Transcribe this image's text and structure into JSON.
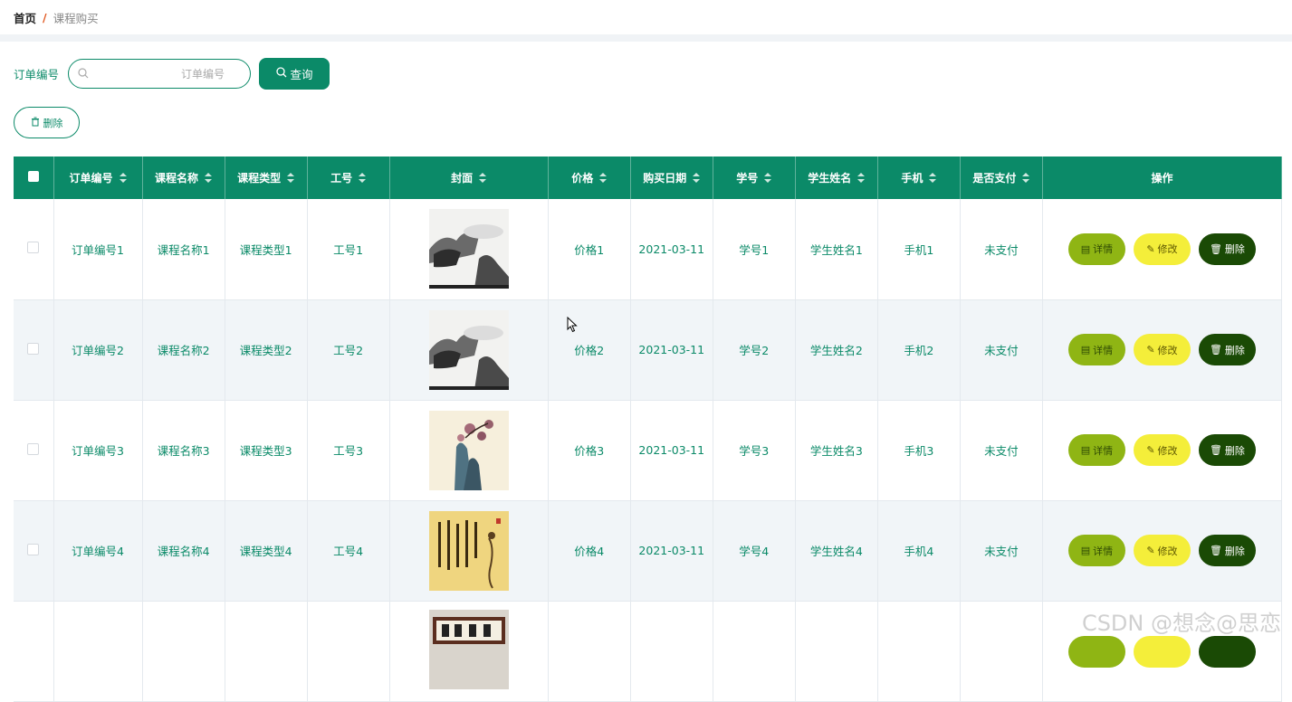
{
  "breadcrumb": {
    "home": "首页",
    "separator": "/",
    "current": "课程购买"
  },
  "search": {
    "label": "订单编号",
    "placeholder": "订单编号",
    "value": "",
    "button_label": "查询"
  },
  "toolbar": {
    "delete_label": "删除"
  },
  "table": {
    "columns": [
      "订单编号",
      "课程名称",
      "课程类型",
      "工号",
      "封面",
      "价格",
      "购买日期",
      "学号",
      "学生姓名",
      "手机",
      "是否支付",
      "操作"
    ],
    "rows": [
      {
        "order_no": "订单编号1",
        "course_name": "课程名称1",
        "course_type": "课程类型1",
        "staff_no": "工号1",
        "cover": "ink-landscape",
        "price": "价格1",
        "date": "2021-03-11",
        "student_no": "学号1",
        "student_name": "学生姓名1",
        "phone": "手机1",
        "paid": "未支付"
      },
      {
        "order_no": "订单编号2",
        "course_name": "课程名称2",
        "course_type": "课程类型2",
        "staff_no": "工号2",
        "cover": "ink-landscape",
        "price": "价格2",
        "date": "2021-03-11",
        "student_no": "学号2",
        "student_name": "学生姓名2",
        "phone": "手机2",
        "paid": "未支付"
      },
      {
        "order_no": "订单编号3",
        "course_name": "课程名称3",
        "course_type": "课程类型3",
        "staff_no": "工号3",
        "cover": "plum-blossom-rock",
        "price": "价格3",
        "date": "2021-03-11",
        "student_no": "学号3",
        "student_name": "学生姓名3",
        "phone": "手机3",
        "paid": "未支付"
      },
      {
        "order_no": "订单编号4",
        "course_name": "课程名称4",
        "course_type": "课程类型4",
        "staff_no": "工号4",
        "cover": "calligraphy-figure",
        "price": "价格4",
        "date": "2021-03-11",
        "student_no": "学号4",
        "student_name": "学生姓名4",
        "phone": "手机4",
        "paid": "未支付"
      },
      {
        "order_no": "",
        "course_name": "",
        "course_type": "",
        "staff_no": "",
        "cover": "framed-calligraphy",
        "price": "",
        "date": "",
        "student_no": "",
        "student_name": "",
        "phone": "",
        "paid": ""
      }
    ],
    "actions": {
      "detail": "详情",
      "edit": "修改",
      "delete": "删除"
    }
  },
  "watermark": "CSDN @想念@思恋",
  "colors": {
    "primary": "#0b8a68",
    "detail": "#8fb514",
    "edit": "#f4ee3a",
    "delete": "#1a4a05",
    "accent_separator": "#e0561e"
  }
}
